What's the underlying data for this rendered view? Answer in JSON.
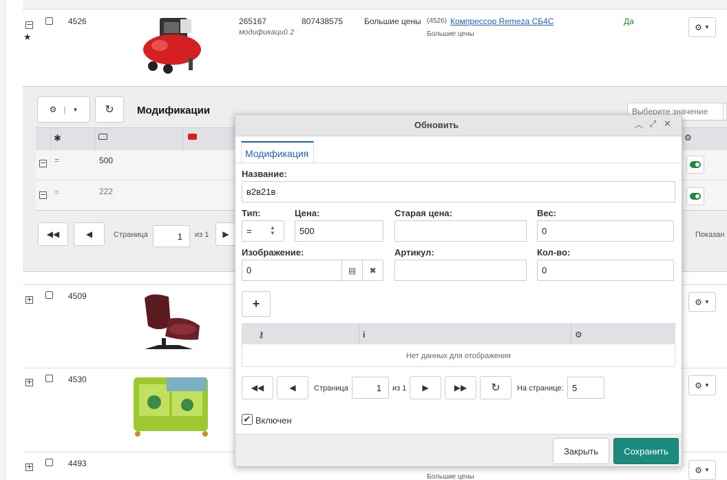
{
  "rows": [
    {
      "id": "4526",
      "code": "265167",
      "mods": "модификаций 2",
      "barcode": "807438575",
      "brand": "Большие цены",
      "link_prefix": "(4526)",
      "link": "Компрессор Remeza СБ4С",
      "link_sub": "Большие цены",
      "active": "Да"
    },
    {
      "id": "4509"
    },
    {
      "id": "4530"
    },
    {
      "id": "4493",
      "link_sub": "Большие цены"
    }
  ],
  "sub": {
    "title": "Модификации",
    "select_placeholder": "Выберите значение",
    "rows": [
      {
        "op": "=",
        "price": "500"
      },
      {
        "op": "=",
        "price": "222"
      }
    ],
    "pager": {
      "page_label": "Страница",
      "page": "1",
      "of": "из 1",
      "shown": "Показан"
    }
  },
  "modal": {
    "title": "Обновить",
    "tab": "Модификация",
    "name_label": "Название:",
    "name_value": "в2в21в",
    "type_label": "Тип:",
    "type_value": "=",
    "price_label": "Цена:",
    "price_value": "500",
    "old_price_label": "Старая цена:",
    "old_price_value": "",
    "weight_label": "Вес:",
    "weight_value": "0",
    "image_label": "Изображение:",
    "image_value": "0",
    "sku_label": "Артикул:",
    "sku_value": "",
    "qty_label": "Кол-во:",
    "qty_value": "0",
    "no_data": "Нет данных для отображения",
    "pager": {
      "page_label": "Страница",
      "page": "1",
      "of": "из 1",
      "per_page_label": "На странице:",
      "per_page": "5"
    },
    "enabled_label": "Включен",
    "close": "Закрыть",
    "save": "Сохранить"
  },
  "colors": {
    "accent": "#1a8b7c",
    "link": "#1d5fb0",
    "active": "#2a8a2a"
  }
}
